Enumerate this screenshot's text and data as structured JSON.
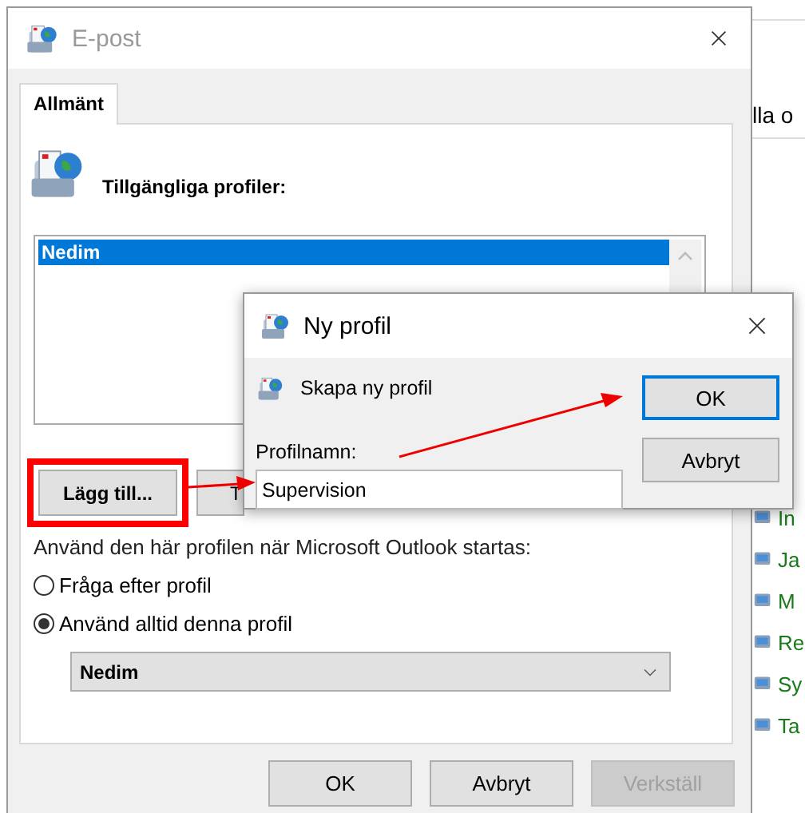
{
  "background_app": {
    "search_text": "lla o",
    "items": [
      {
        "label": "In",
        "icon": true
      },
      {
        "label": "Ja",
        "icon": true
      },
      {
        "label": "M",
        "icon": true
      },
      {
        "label": "Re",
        "icon": true
      },
      {
        "label": "Sy",
        "icon": true
      },
      {
        "label": "Ta",
        "icon": true
      }
    ]
  },
  "main_dialog": {
    "title": "E-post",
    "tabs": [
      {
        "label": "Allmänt",
        "selected": true
      }
    ],
    "profiles_label": "Tillgängliga profiler:",
    "profiles": [
      {
        "name": "Nedim",
        "selected": true
      }
    ],
    "profile_buttons": [
      {
        "label": "Lägg till...",
        "highlighted": true
      },
      {
        "label": "T",
        "highlighted": false
      }
    ],
    "startup_label": "Använd den här profilen när Microsoft Outlook startas:",
    "startup_options": [
      {
        "label": "Fråga efter profil",
        "selected": false
      },
      {
        "label": "Använd alltid denna profil",
        "selected": true
      }
    ],
    "profile_dropdown": {
      "value": "Nedim"
    },
    "buttons": [
      {
        "label": "OK",
        "disabled": false
      },
      {
        "label": "Avbryt",
        "disabled": false
      },
      {
        "label": "Verkställ",
        "disabled": true
      }
    ]
  },
  "new_profile_dialog": {
    "title": "Ny profil",
    "heading": "Skapa ny profil",
    "name_label": "Profilnamn:",
    "name_value": "Supervision",
    "buttons": [
      {
        "label": "OK",
        "default": true
      },
      {
        "label": "Avbryt",
        "default": false
      }
    ]
  }
}
